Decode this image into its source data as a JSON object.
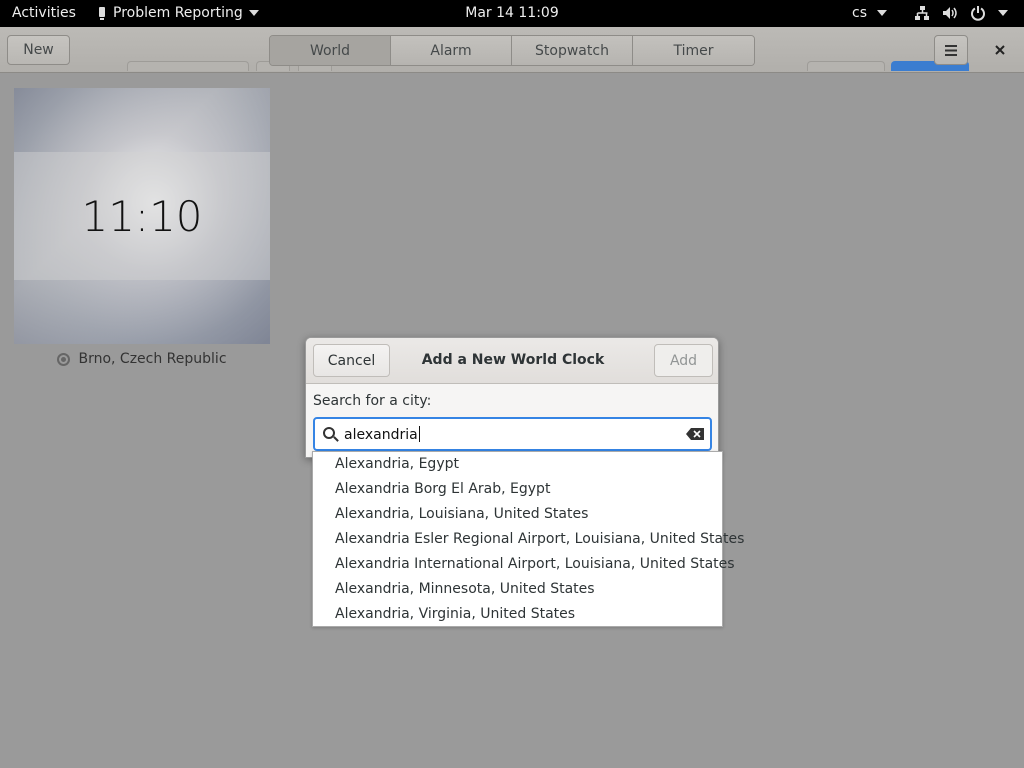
{
  "topbar": {
    "activities": "Activities",
    "app_name": "Problem Reporting",
    "datetime": "Mar 14  11:09",
    "input_lang": "cs"
  },
  "header": {
    "new_label": "New",
    "tabs": [
      "World",
      "Alarm",
      "Stopwatch",
      "Timer"
    ],
    "active_tab": "World"
  },
  "clock_tile": {
    "time": "11:10",
    "city": "Brno, Czech Republic"
  },
  "dialog": {
    "title": "Add a New World Clock",
    "cancel_label": "Cancel",
    "add_label": "Add",
    "search_label": "Search for a city:",
    "search_value": "alexandria"
  },
  "results": [
    "Alexandria, Egypt",
    "Alexandria Borg El Arab, Egypt",
    "Alexandria, Louisiana, United States",
    "Alexandria Esler Regional Airport, Louisiana, United States",
    "Alexandria International Airport, Louisiana, United States",
    "Alexandria, Minnesota, United States",
    "Alexandria, Virginia, United States"
  ],
  "colors": {
    "accent": "#3584e4",
    "topbar": "#000000",
    "dimmed_background": "#9a9a9a"
  }
}
